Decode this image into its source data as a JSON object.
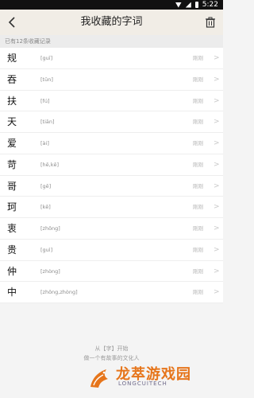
{
  "status": {
    "time": "5:22"
  },
  "header": {
    "title": "我收藏的字词"
  },
  "subheader": {
    "count_text": "已有12条收藏记录"
  },
  "items": [
    {
      "char": "规",
      "pinyin": "[guī]",
      "time": "刚刚"
    },
    {
      "char": "吞",
      "pinyin": "[tūn]",
      "time": "刚刚"
    },
    {
      "char": "扶",
      "pinyin": "[fú]",
      "time": "刚刚"
    },
    {
      "char": "天",
      "pinyin": "[tiān]",
      "time": "刚刚"
    },
    {
      "char": "爱",
      "pinyin": "[ài]",
      "time": "刚刚"
    },
    {
      "char": "苛",
      "pinyin": "[hē,kē]",
      "time": "刚刚"
    },
    {
      "char": "哥",
      "pinyin": "[gē]",
      "time": "刚刚"
    },
    {
      "char": "珂",
      "pinyin": "[kē]",
      "time": "刚刚"
    },
    {
      "char": "衷",
      "pinyin": "[zhōng]",
      "time": "刚刚"
    },
    {
      "char": "贵",
      "pinyin": "[guì]",
      "time": "刚刚"
    },
    {
      "char": "仲",
      "pinyin": "[zhòng]",
      "time": "刚刚"
    },
    {
      "char": "中",
      "pinyin": "[zhōng,zhòng]",
      "time": "刚刚"
    }
  ],
  "footer": {
    "line1": "从【字】开始",
    "line2": "做一个有故事的文化人"
  },
  "watermark": {
    "brand": "龙萃游戏园",
    "sub": "LONGCUITECH"
  },
  "colors": {
    "accent": "#e6751b",
    "header_bg": "#f1ede6"
  },
  "icons": {
    "back": "chevron-left-icon",
    "delete": "trash-icon",
    "row": "chevron-right-icon"
  }
}
